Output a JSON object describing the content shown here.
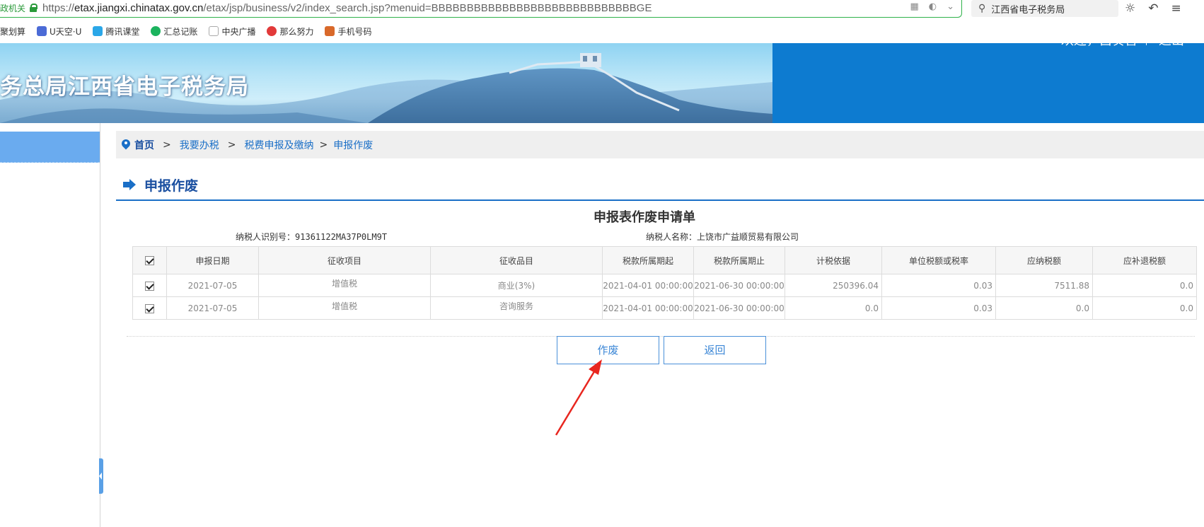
{
  "browser": {
    "secure_label": "政机关",
    "url_scheme": "https://",
    "url_host": "etax.jiangxi.chinatax.gov.cn",
    "url_path": "/etax/jsp/business/v2/index_search.jsp?menuid=BBBBBBBBBBBBBBBBBBBBBBBBBBBBBGE",
    "search_text": "江西省电子税务局"
  },
  "bookmarks": [
    {
      "label": "聚划算",
      "color": "#e33"
    },
    {
      "label": "U天空·U",
      "color": "#4b6bd6"
    },
    {
      "label": "腾讯课堂",
      "color": "#2aa7e8"
    },
    {
      "label": "汇总记账",
      "color": "#1bb35e"
    },
    {
      "label": "中央广播",
      "color": "#ccc"
    },
    {
      "label": "那么努力",
      "color": "#e23a3a"
    },
    {
      "label": "手机号码",
      "color": "#d9692a"
    }
  ],
  "banner": {
    "title": "务总局江西省电子税务局",
    "welcome": "欢迎，吕奏喜",
    "logout": "退出"
  },
  "breadcrumb": {
    "home": "首页",
    "sep": ">",
    "items": [
      "我要办税",
      "税费申报及缴纳",
      "申报作废"
    ]
  },
  "page": {
    "title": "申报作废",
    "form_title": "申报表作废申请单",
    "taxpayer_id_label": "纳税人识别号：",
    "taxpayer_id": "91361122MA37P0LM9T",
    "taxpayer_name_label": "纳税人名称：",
    "taxpayer_name": "上饶市广益顺贸易有限公司"
  },
  "table": {
    "headers": [
      "申报日期",
      "征收项目",
      "征收品目",
      "税款所属期起",
      "税款所属期止",
      "计税依据",
      "单位税额或税率",
      "应纳税额",
      "应补退税额"
    ],
    "rows": [
      [
        "2021-07-05",
        "增值税",
        "商业(3%)",
        "2021-04-01 00:00:00",
        "2021-06-30 00:00:00",
        "250396.04",
        "0.03",
        "7511.88",
        "0.0"
      ],
      [
        "2021-07-05",
        "增值税",
        "咨询服务",
        "2021-04-01 00:00:00",
        "2021-06-30 00:00:00",
        "0.0",
        "0.03",
        "0.0",
        "0.0"
      ]
    ]
  },
  "buttons": {
    "void": "作废",
    "back": "返回"
  },
  "colors": {
    "brand_blue": "#0d7bd0",
    "link_blue": "#1a6fc7",
    "annotation_red": "#e8261f"
  }
}
